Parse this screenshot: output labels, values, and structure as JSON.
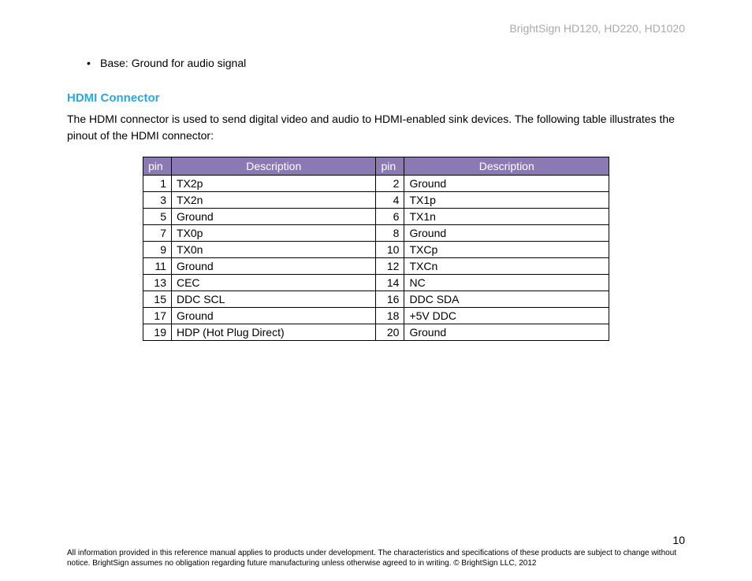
{
  "header": {
    "product_line": "BrightSign HD120, HD220, HD1020"
  },
  "bullet": {
    "text": "Base: Ground for audio signal"
  },
  "section": {
    "heading": "HDMI Connector",
    "body": "The HDMI connector is used to send digital video and audio to HDMI-enabled sink devices. The following table illustrates the pinout of the HDMI connector:"
  },
  "table": {
    "headers": {
      "pin": "pin",
      "description": "Description"
    },
    "rows": [
      {
        "pin1": "1",
        "desc1": "TX2p",
        "pin2": "2",
        "desc2": "Ground"
      },
      {
        "pin1": "3",
        "desc1": "TX2n",
        "pin2": "4",
        "desc2": "TX1p"
      },
      {
        "pin1": "5",
        "desc1": "Ground",
        "pin2": "6",
        "desc2": "TX1n"
      },
      {
        "pin1": "7",
        "desc1": "TX0p",
        "pin2": "8",
        "desc2": "Ground"
      },
      {
        "pin1": "9",
        "desc1": "TX0n",
        "pin2": "10",
        "desc2": "TXCp"
      },
      {
        "pin1": "11",
        "desc1": "Ground",
        "pin2": "12",
        "desc2": "TXCn"
      },
      {
        "pin1": "13",
        "desc1": "CEC",
        "pin2": "14",
        "desc2": "NC"
      },
      {
        "pin1": "15",
        "desc1": "DDC SCL",
        "pin2": "16",
        "desc2": "DDC SDA"
      },
      {
        "pin1": "17",
        "desc1": "Ground",
        "pin2": "18",
        "desc2": "+5V DDC"
      },
      {
        "pin1": "19",
        "desc1": "HDP (Hot Plug Direct)",
        "pin2": "20",
        "desc2": "Ground"
      }
    ]
  },
  "footer": {
    "page_number": "10",
    "disclaimer": "All information provided in this reference manual applies to products under development. The characteristics and specifications of these products are subject to change without notice. BrightSign assumes no obligation regarding future manufacturing unless otherwise agreed to in writing. © BrightSign LLC, 2012"
  }
}
